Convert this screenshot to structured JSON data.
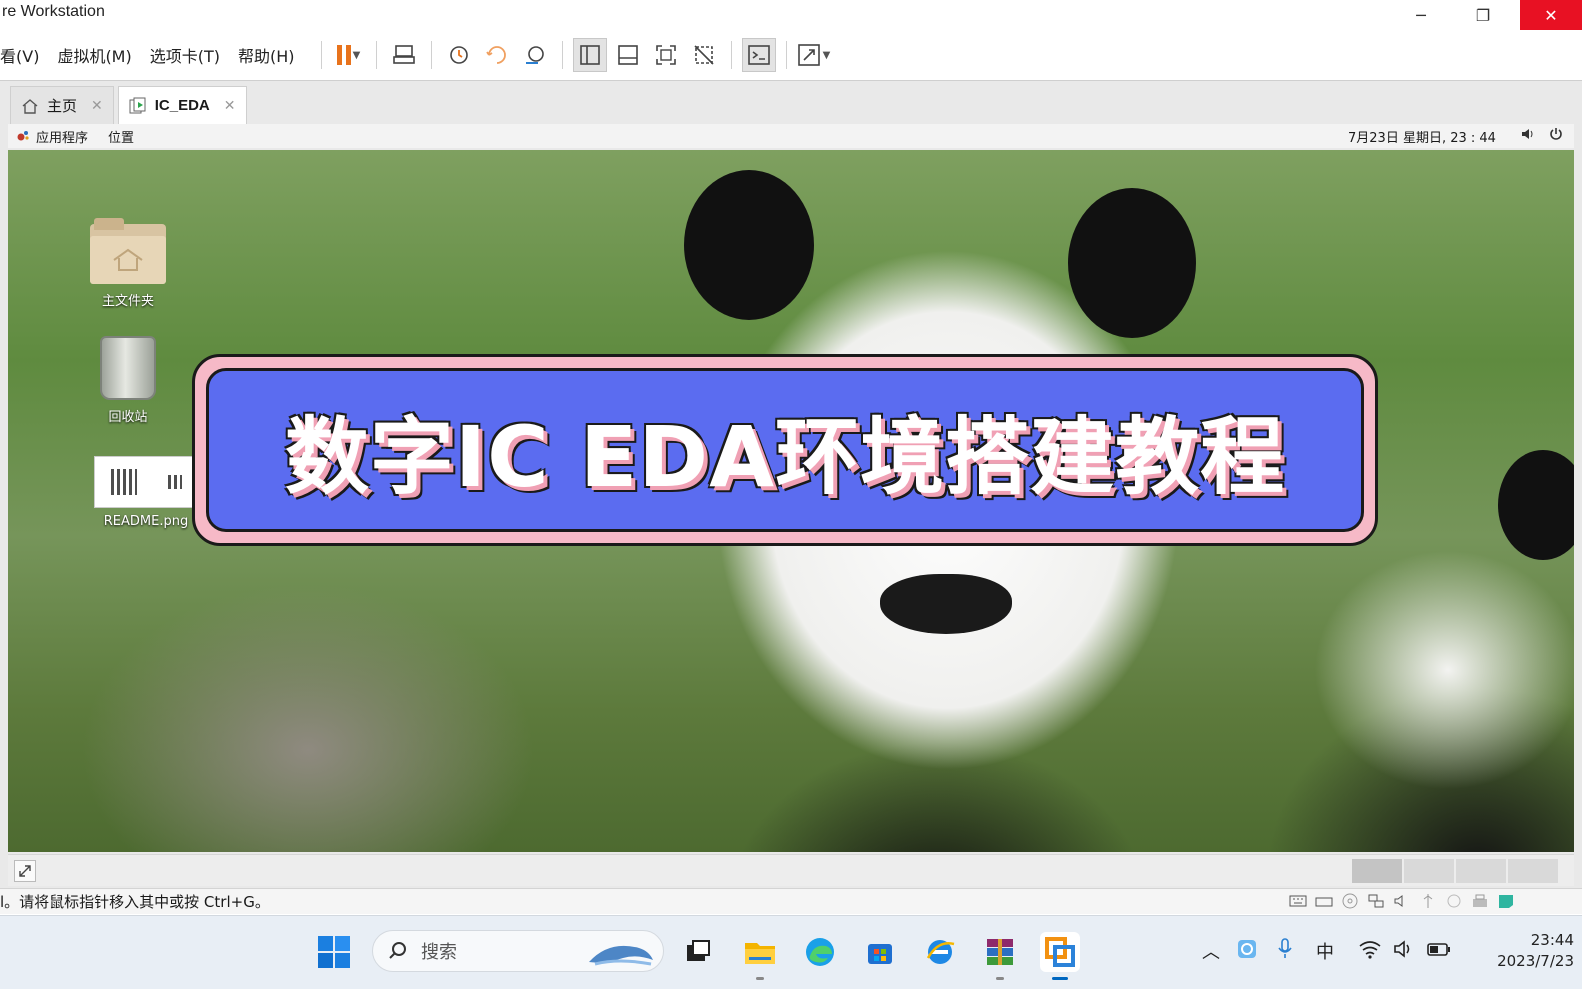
{
  "window": {
    "title": "re Workstation",
    "min_label": "─",
    "restore_label": "❐",
    "close_label": "✕"
  },
  "menu": {
    "items": [
      "看(V)",
      "虚拟机(M)",
      "选项卡(T)",
      "帮助(H)"
    ]
  },
  "toolbar": {
    "icons": [
      "pause-icon",
      "send-ctrl-alt-del-icon",
      "snapshot-icon",
      "revert-snapshot-icon",
      "snapshot-manager-icon",
      "show-library-icon",
      "show-thumbnail-icon",
      "full-screen-icon",
      "unity-icon",
      "console-view-icon",
      "stretch-guest-icon"
    ]
  },
  "tabs": [
    {
      "label": "主页",
      "icon": "home-icon",
      "active": false
    },
    {
      "label": "IC_EDA",
      "icon": "vm-icon",
      "active": true
    }
  ],
  "guest_panel": {
    "applications": "应用程序",
    "places": "位置",
    "clock": "7月23日 星期日, 23 : 44"
  },
  "desktop_icons": [
    {
      "label": "主文件夹",
      "icon": "home-folder-icon"
    },
    {
      "label": "回收站",
      "icon": "trash-icon"
    },
    {
      "label": "README.png",
      "icon": "image-file-icon"
    }
  ],
  "banner": {
    "text": "数字IC  EDA环境搭建教程",
    "bg_color": "#5b6cf0",
    "frame_color": "#f6b9c7"
  },
  "status": {
    "message": "l。请将鼠标指针移入其中或按 Ctrl+G。"
  },
  "taskbar": {
    "search_placeholder": "搜索",
    "ime_label": "中",
    "time": "23:44",
    "date": "2023/7/23",
    "accent": "#0067c0"
  }
}
